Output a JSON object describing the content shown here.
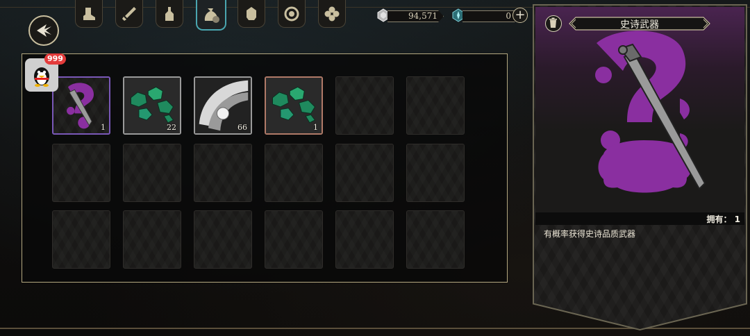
{
  "header": {
    "back_icon": "back-arrow-icon",
    "tabs": [
      {
        "icon": "boot-icon"
      },
      {
        "icon": "sword-icon"
      },
      {
        "icon": "potion-icon"
      },
      {
        "icon": "pouch-icon",
        "active": true
      },
      {
        "icon": "helmet-icon"
      },
      {
        "icon": "ring-icon"
      },
      {
        "icon": "clover-icon"
      }
    ]
  },
  "currency": {
    "silver": {
      "icon": "silver-gem-icon",
      "value": "94,571"
    },
    "crystal": {
      "icon": "crystal-gem-icon",
      "value": "0"
    },
    "add_icon": "plus-icon"
  },
  "qq": {
    "badge": "999",
    "icon": "qq-penguin-icon"
  },
  "inventory": {
    "items": [
      {
        "kind": "epic-weapon-box",
        "count": "1",
        "rarity": "epic"
      },
      {
        "kind": "green-ore",
        "count": "22",
        "rarity": "common"
      },
      {
        "kind": "pearl-shell",
        "count": "66",
        "rarity": "common"
      },
      {
        "kind": "green-ore",
        "count": "1",
        "rarity": "rare"
      }
    ]
  },
  "detail": {
    "title": "史诗武器",
    "owned_label": "拥有：",
    "owned_value": "1",
    "description": "有概率获得史诗品质武器",
    "delete_icon": "trash-icon"
  },
  "colors": {
    "accent": "#4aa6b0",
    "epic": "#8a2fa0",
    "frame": "#b4a880"
  }
}
